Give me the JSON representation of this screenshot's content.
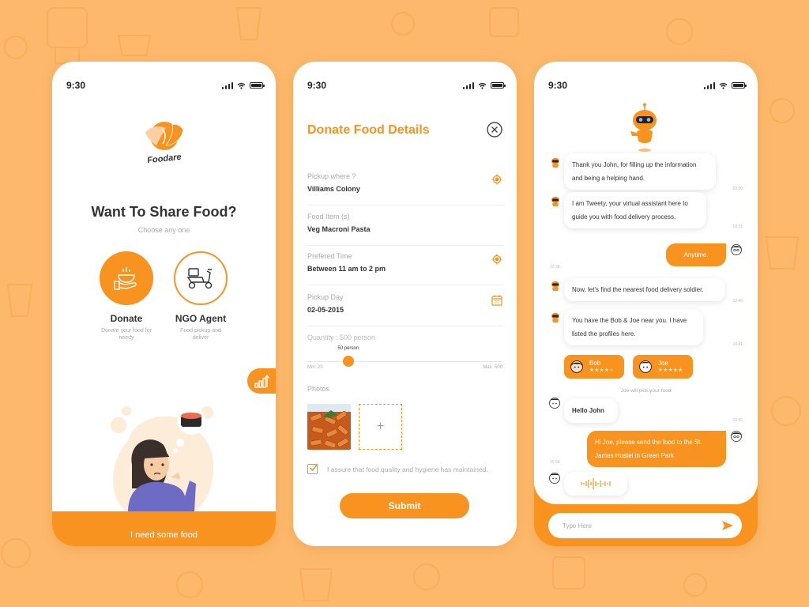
{
  "colors": {
    "accent": "#f7931e",
    "background": "#fdb86b",
    "text_dark": "#333333",
    "text_muted": "#aaaaaa"
  },
  "status_bar": {
    "time": "9:30"
  },
  "screen_choose": {
    "brand": "Foodare",
    "title": "Want To Share Food?",
    "subtitle": "Choose any one",
    "options": [
      {
        "label": "Donate",
        "description": "Donate your food for needy",
        "icon": "hand-bowl-icon"
      },
      {
        "label": "NGO Agent",
        "description": "Food pickup and deliver",
        "icon": "scooter-icon"
      }
    ],
    "side_tab_icon": "chart-growth-icon",
    "bottom_label": "I need some food"
  },
  "screen_donate": {
    "title": "Donate Food Details",
    "fields": [
      {
        "label": "Pickup where ?",
        "value": "Villiams Colony",
        "icon": "location-target-icon"
      },
      {
        "label": "Food Item (s)",
        "value": "Veg Macroni Pasta",
        "icon": ""
      },
      {
        "label": "Prefered Time",
        "value": "Between 11 am to 2 pm",
        "icon": "location-target-icon"
      },
      {
        "label": "Pickup Day",
        "value": "02-05-2015",
        "icon": "calendar-icon"
      }
    ],
    "quantity": {
      "label": "Quantity :  500 person",
      "current_label": "50 person",
      "min_label": "Min: 20",
      "max_label": "Max: 500",
      "min": 20,
      "max": 500,
      "value": 50
    },
    "photos_label": "Photos",
    "add_photo_symbol": "+",
    "assurance_text": "I assure that food quality and hygiene has maintained.",
    "assurance_checked": true,
    "submit_label": "Submit"
  },
  "screen_chat": {
    "messages": [
      {
        "from": "bot",
        "text": "Thank you John, for filling up the information and being a helping hand.",
        "time": "10:30"
      },
      {
        "from": "bot",
        "text": "I am Tweety, your virtual assistant here to guide you with food delivery process.",
        "time": "10:31"
      },
      {
        "from": "user",
        "text": "Anytime.",
        "time": "10:38"
      },
      {
        "from": "bot",
        "text": "Now, let's find the nearest food delivery soldier.",
        "time": "10:40"
      },
      {
        "from": "bot",
        "text": "You have the Bob & Joe near you. I have listed the profiles here.",
        "time": "10:41"
      },
      {
        "from": "agent",
        "text": "Hello John",
        "time": "10:50"
      },
      {
        "from": "user",
        "text": "Hi Joe, please send the food to the St. James Hostel in Green Park",
        "time": "10:58"
      }
    ],
    "profiles": [
      {
        "name": "Bob",
        "stars": "★★★★☆",
        "rating": 4
      },
      {
        "name": "Joe",
        "stars": "★★★★★",
        "rating": 5
      }
    ],
    "pick_note": "Joe  will pick your food",
    "input_placeholder": "Type Here"
  }
}
